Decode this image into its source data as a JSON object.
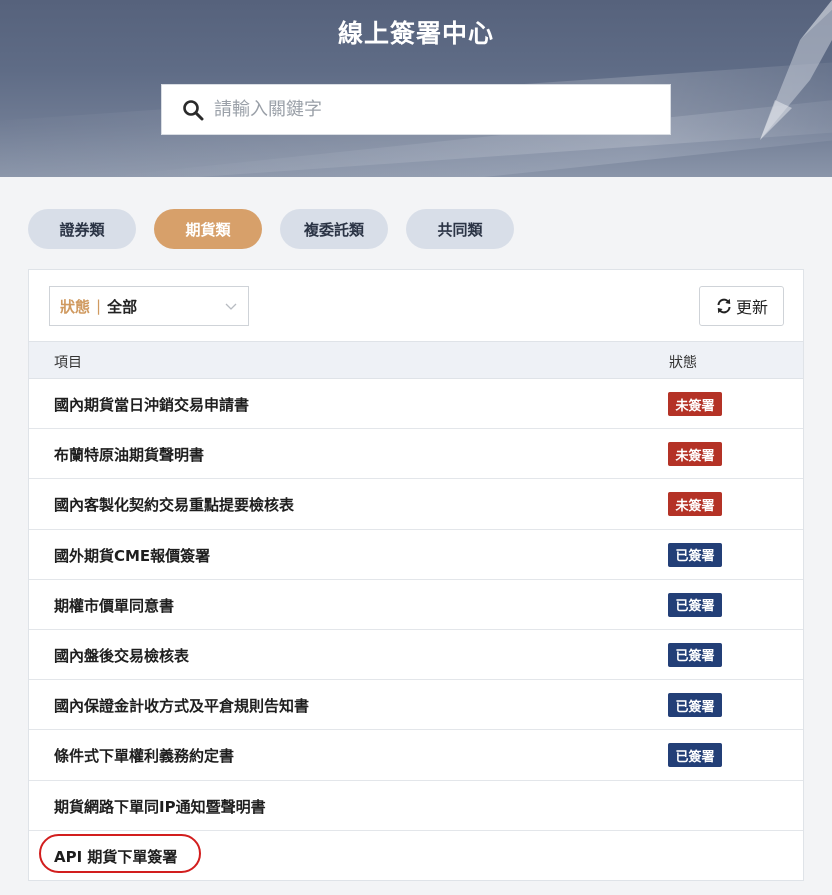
{
  "header": {
    "title": "線上簽署中心",
    "search": {
      "placeholder": "請輸入關鍵字",
      "value": ""
    }
  },
  "tabs": [
    {
      "label": "證券類",
      "active": false
    },
    {
      "label": "期貨類",
      "active": true
    },
    {
      "label": "複委託類",
      "active": false
    },
    {
      "label": "共同類",
      "active": false
    }
  ],
  "filter": {
    "label": "狀態",
    "separator": "|",
    "value": "全部"
  },
  "refresh_label": "更新",
  "table": {
    "columns": [
      "項目",
      "狀態"
    ],
    "rows": [
      {
        "name": "國內期貨當日沖銷交易申請書",
        "status": "未簽署",
        "status_type": "unsigned"
      },
      {
        "name": "布蘭特原油期貨聲明書",
        "status": "未簽署",
        "status_type": "unsigned"
      },
      {
        "name": "國內客製化契約交易重點提要檢核表",
        "status": "未簽署",
        "status_type": "unsigned"
      },
      {
        "name": "國外期貨CME報價簽署",
        "status": "已簽署",
        "status_type": "signed"
      },
      {
        "name": "期權市價單同意書",
        "status": "已簽署",
        "status_type": "signed"
      },
      {
        "name": "國內盤後交易檢核表",
        "status": "已簽署",
        "status_type": "signed"
      },
      {
        "name": "國內保證金計收方式及平倉規則告知書",
        "status": "已簽署",
        "status_type": "signed"
      },
      {
        "name": "條件式下單權利義務約定書",
        "status": "已簽署",
        "status_type": "signed"
      },
      {
        "name": "期貨網路下單同IP通知暨聲明書",
        "status": "",
        "status_type": "none"
      },
      {
        "name": "API 期貨下單簽署",
        "status": "",
        "status_type": "none"
      }
    ]
  },
  "colors": {
    "accent": "#d7a06a",
    "unsigned": "#b43226",
    "signed": "#233f77",
    "highlight": "#d21e1e"
  }
}
